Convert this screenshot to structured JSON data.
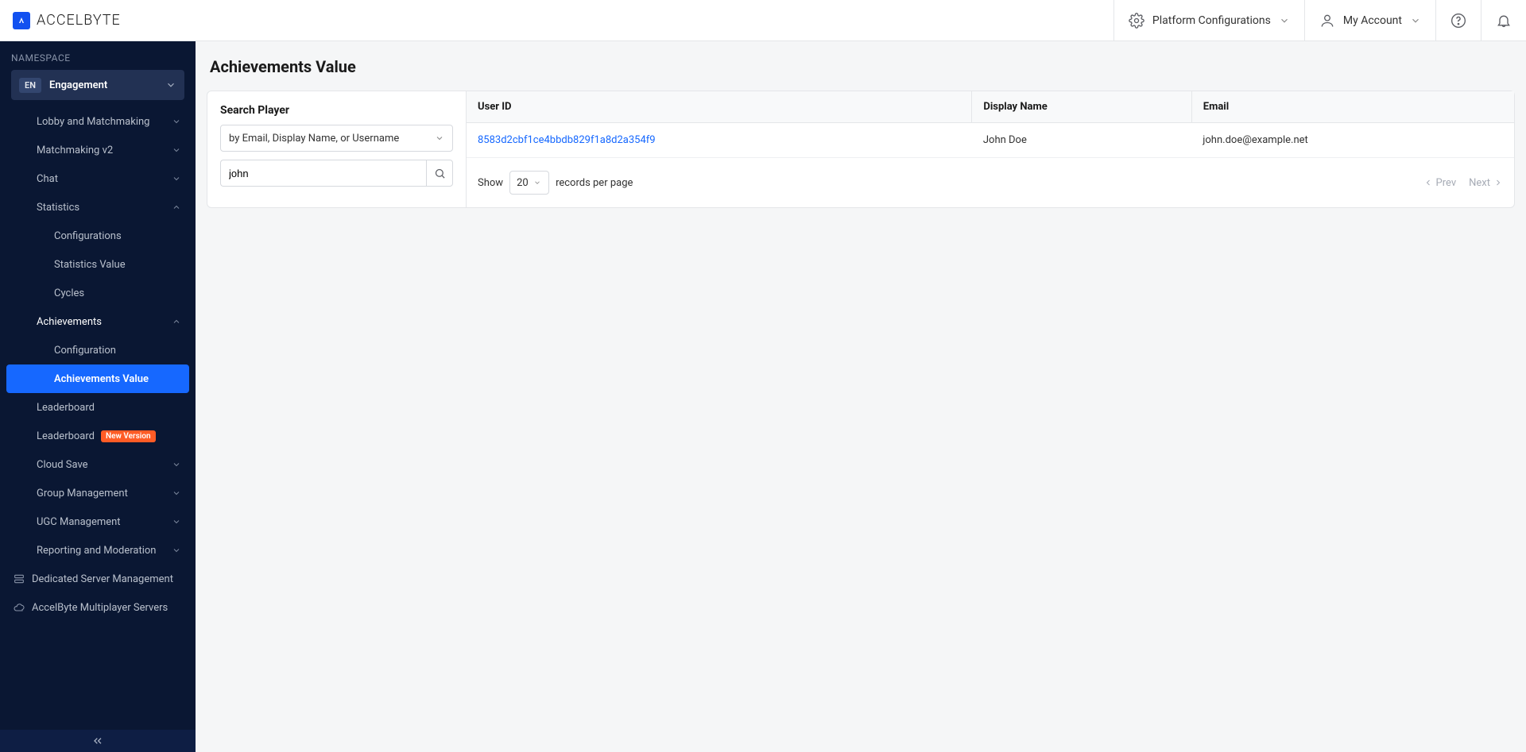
{
  "brand": {
    "name": "ACCELBYTE"
  },
  "header": {
    "platform_config": "Platform Configurations",
    "my_account": "My Account"
  },
  "sidebar": {
    "namespace_label": "NAMESPACE",
    "namespace_tag": "EN",
    "namespace_name": "Engagement",
    "items": {
      "lobby": "Lobby and Matchmaking",
      "mmv2": "Matchmaking v2",
      "chat": "Chat",
      "statistics": "Statistics",
      "stat_config": "Configurations",
      "stat_value": "Statistics Value",
      "stat_cycles": "Cycles",
      "achievements": "Achievements",
      "ach_config": "Configuration",
      "ach_value": "Achievements Value",
      "leaderboard": "Leaderboard",
      "leaderboard2": "Leaderboard",
      "leaderboard2_badge": "New Version",
      "cloudsave": "Cloud Save",
      "group": "Group Management",
      "ugc": "UGC Management",
      "reporting": "Reporting and Moderation",
      "dsm": "Dedicated Server Management",
      "ams": "AccelByte Multiplayer Servers"
    }
  },
  "page": {
    "title": "Achievements Value"
  },
  "search": {
    "heading": "Search Player",
    "mode": "by Email, Display Name, or Username",
    "query": "john"
  },
  "table": {
    "headers": {
      "uid": "User ID",
      "dname": "Display Name",
      "email": "Email"
    },
    "rows": [
      {
        "uid": "8583d2cbf1ce4bbdb829f1a8d2a354f9",
        "dname": "John Doe",
        "email": "john.doe@example.net"
      }
    ]
  },
  "pager": {
    "show": "Show",
    "page_size": "20",
    "rpp": "records per page",
    "prev": "Prev",
    "next": "Next"
  }
}
